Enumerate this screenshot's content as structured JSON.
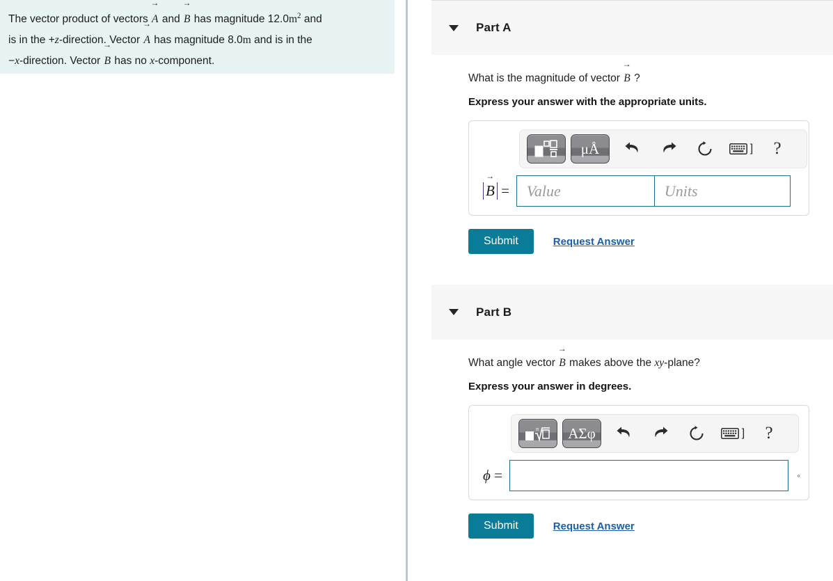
{
  "problem": {
    "line1_a": "The vector product of vectors",
    "vec_a": "A",
    "and": "and",
    "vec_b": "B",
    "line1_b": "has magnitude 12.0",
    "unit_m": "m",
    "exp2": "2",
    "line1_c": "and",
    "line2_a": "is in the +",
    "axis_z": "z",
    "line2_b": "-direction. Vector",
    "line2_c": "has magnitude 8.0",
    "line2_d": "and is in the",
    "line3_a": "−",
    "axis_x": "x",
    "line3_b": "-direction. Vector",
    "line3_c": "has no",
    "line3_d": "-component."
  },
  "parts": [
    {
      "title": "Part A",
      "caret": "chevron-down-icon",
      "question_pre": "What is the magnitude of vector",
      "question_vec": "B",
      "question_post": "?",
      "instruction": "Express your answer with the appropriate units.",
      "toolbar": {
        "template_button": "template-icon",
        "units_button": "μÅ",
        "undo_button": "undo-icon",
        "redo_button": "redo-icon",
        "reset_button": "reset-icon",
        "keyboard_button": "keyboard-icon",
        "keyboard_bracket": "]",
        "help_button": "?"
      },
      "answer_label_var": "B",
      "answer_label_eq": "=",
      "value_placeholder": "Value",
      "units_placeholder": "Units",
      "value": "",
      "units": "",
      "submit_label": "Submit",
      "request_label": "Request Answer"
    },
    {
      "title": "Part B",
      "caret": "chevron-down-icon",
      "question_pre": "What angle vector",
      "question_vec": "B",
      "question_mid": "makes above the",
      "question_plane": "xy",
      "question_post": "-plane?",
      "instruction": "Express your answer in degrees.",
      "toolbar": {
        "template_button": "sqrt-icon",
        "greek_button": "ΑΣφ",
        "undo_button": "undo-icon",
        "redo_button": "redo-icon",
        "reset_button": "reset-icon",
        "keyboard_button": "keyboard-icon",
        "keyboard_bracket": "]",
        "help_button": "?"
      },
      "answer_label_var": "ϕ",
      "answer_label_eq": "=",
      "value": "",
      "degree_symbol": "◦",
      "submit_label": "Submit",
      "request_label": "Request Answer"
    }
  ],
  "colors": {
    "panel_bg": "#e7f4f3",
    "divider": "#b9c8d8",
    "part_header_bg": "#f7f7f7",
    "submit_bg": "#0b7c98",
    "link": "#1a5fa8",
    "input_border": "#1b6f8a"
  }
}
